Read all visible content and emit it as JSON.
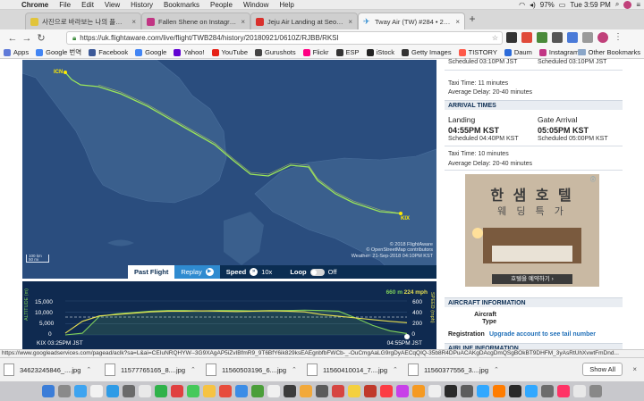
{
  "menubar": {
    "app": "Chrome",
    "items": [
      "File",
      "Edit",
      "View",
      "History",
      "Bookmarks",
      "People",
      "Window",
      "Help"
    ],
    "clock": "Tue 3:59 PM",
    "battery": "97%"
  },
  "tabs": [
    {
      "title": "사진으로 바라보는 나의 플레이스 - ...",
      "color": "#e1c43a"
    },
    {
      "title": "Fallen Shene on Instagram: \"A...",
      "color": "#c13584"
    },
    {
      "title": "Jeju Air Landing at Seoul Ic...",
      "color": "#d9302c"
    },
    {
      "title": "Tway Air (TW) #284 • 21-Sep...",
      "color": "#2f8bd0"
    }
  ],
  "address": {
    "url": "https://uk.flightaware.com/live/flight/TWB284/history/20180921/0610Z/RJBB/RKSI"
  },
  "bookmarks": [
    {
      "label": "Apps",
      "color": "#5f7ad8"
    },
    {
      "label": "Google 번역",
      "color": "#4285f4"
    },
    {
      "label": "Facebook",
      "color": "#3b5998"
    },
    {
      "label": "Google",
      "color": "#4285f4"
    },
    {
      "label": "Yahoo!",
      "color": "#6001d2"
    },
    {
      "label": "YouTube",
      "color": "#e62117"
    },
    {
      "label": "Gurushots",
      "color": "#444444"
    },
    {
      "label": "Flickr",
      "color": "#ff0084"
    },
    {
      "label": "ESP",
      "color": "#333333"
    },
    {
      "label": "iStock",
      "color": "#222222"
    },
    {
      "label": "Getty Images",
      "color": "#333333"
    },
    {
      "label": "TISTORY",
      "color": "#ff5a4a"
    },
    {
      "label": "Daum",
      "color": "#2c6bd9"
    },
    {
      "label": "Instagram",
      "color": "#c13584"
    }
  ],
  "bookmarks_other": "Other Bookmarks",
  "map": {
    "origin_label": "ICN",
    "dest_label": "KIX",
    "attribution_line1": "© 2018 FlightAware",
    "attribution_line2": "© OpenStreetMap contributors",
    "attribution_line3": "Weather: 21-Sep-2018 04:10PM KST",
    "scale_label1": "100 km",
    "scale_label2": "50 mi"
  },
  "controls": {
    "past_flight": "Past Flight",
    "replay": "Replay",
    "speed_label": "Speed",
    "speed_value": "10x",
    "loop_label": "Loop",
    "loop_state": "Off"
  },
  "altitude_chart": {
    "left_axis_label": "ALTITUDE (m)",
    "right_axis_label": "SPEED (mph)",
    "left_ticks": [
      "15,000",
      "10,000",
      "5,000",
      "0"
    ],
    "right_ticks": [
      "600",
      "400",
      "200",
      "0"
    ],
    "current_alt": "660 m",
    "current_speed": "224 mph",
    "start_label": "KIX 03:25PM JST",
    "end_label": "04:55PM JST",
    "altitude_series": [
      0,
      0.05,
      0.55,
      0.62,
      0.66,
      0.7,
      0.72,
      0.72,
      0.71,
      0.72,
      0.72,
      0.71,
      0.72,
      0.72,
      0.73,
      0.72,
      0.7,
      0.5,
      0.28,
      0.12,
      0.04
    ],
    "speed_series": [
      0.05,
      0.4,
      0.56,
      0.6,
      0.64,
      0.68,
      0.7,
      0.7,
      0.71,
      0.7,
      0.69,
      0.7,
      0.71,
      0.7,
      0.68,
      0.6,
      0.55,
      0.5,
      0.45,
      0.4,
      0.36
    ]
  },
  "departure": {
    "scheduled_left": "Scheduled 03:10PM JST",
    "scheduled_right": "Scheduled 03:10PM JST",
    "taxi_time": "Taxi Time: 11 minutes",
    "avg_delay": "Average Delay: 20-40 minutes"
  },
  "arrival": {
    "header": "ARRIVAL TIMES",
    "landing_label": "Landing",
    "landing_time": "04:55PM KST",
    "landing_sched": "Scheduled 04:40PM KST",
    "gate_label": "Gate Arrival",
    "gate_time": "05:05PM KST",
    "gate_sched": "Scheduled 05:00PM KST",
    "taxi_time": "Taxi Time: 10 minutes",
    "avg_delay": "Average Delay: 20-40 minutes"
  },
  "ad": {
    "title": "한 샘 호 텔",
    "subtitle": "웨 딩 특 가",
    "cta": "호텔을 예약하기 ›"
  },
  "aircraft": {
    "header": "AIRCRAFT INFORMATION",
    "type_label": "Aircraft Type",
    "registration_label": "Registration",
    "registration_value": "Upgrade account to see tail number",
    "next_header": "AIRLINE INFORMATION"
  },
  "status_url": "https://www.googleadservices.com/pagead/aclk?sa=L&ai=CEIuNRQHYW--3G9XAgAP5iZvIBfmR9_9T6BfY6ik829ksEAEgnbfbFWCb-_-OuCmgAaLG9rgDyAECqQIQ-35b8R4DPuACAKgDAcgDmQSgBOkBT9DHFM_3yAsRtUhXvwtFmDnd...",
  "downloads": [
    {
      "name": "34623245846_....jpg"
    },
    {
      "name": "11577765165_8....jpg"
    },
    {
      "name": "11560503196_6....jpg"
    },
    {
      "name": "11560410014_7....jpg"
    },
    {
      "name": "11560377556_3....jpg"
    }
  ],
  "downloads_showall": "Show All",
  "dock": [
    {
      "color": "#3b7dd8"
    },
    {
      "color": "#8a8a8a"
    },
    {
      "color": "#3ea4f0"
    },
    {
      "color": "#f2f2f2"
    },
    {
      "color": "#2e9be6"
    },
    {
      "color": "#6a6a6a"
    },
    {
      "color": "#e9e9e9"
    },
    {
      "color": "#2fb24a"
    },
    {
      "color": "#e04040"
    },
    {
      "color": "#45c95a"
    },
    {
      "color": "#f6c343"
    },
    {
      "color": "#e74c3c"
    },
    {
      "color": "#3c8de6"
    },
    {
      "color": "#4b9e3a"
    },
    {
      "color": "#f0f0f0"
    },
    {
      "color": "#3c3c3c"
    },
    {
      "color": "#f2a93b"
    },
    {
      "color": "#5b5b5b"
    },
    {
      "color": "#d64541"
    },
    {
      "color": "#f4d03f"
    },
    {
      "color": "#c0392b"
    },
    {
      "color": "#fc3c44"
    },
    {
      "color": "#c840e9"
    },
    {
      "color": "#f59a23"
    },
    {
      "color": "#efefef"
    },
    {
      "color": "#2a2a2a"
    },
    {
      "color": "#5d5d5d"
    },
    {
      "color": "#31a8ff"
    },
    {
      "color": "#ff7c00"
    },
    {
      "color": "#2a2a2a"
    },
    {
      "color": "#31a8ff"
    },
    {
      "color": "#6c6c6c"
    },
    {
      "color": "#ff3366"
    },
    {
      "color": "#e8e8e8"
    },
    {
      "color": "#888888"
    }
  ]
}
